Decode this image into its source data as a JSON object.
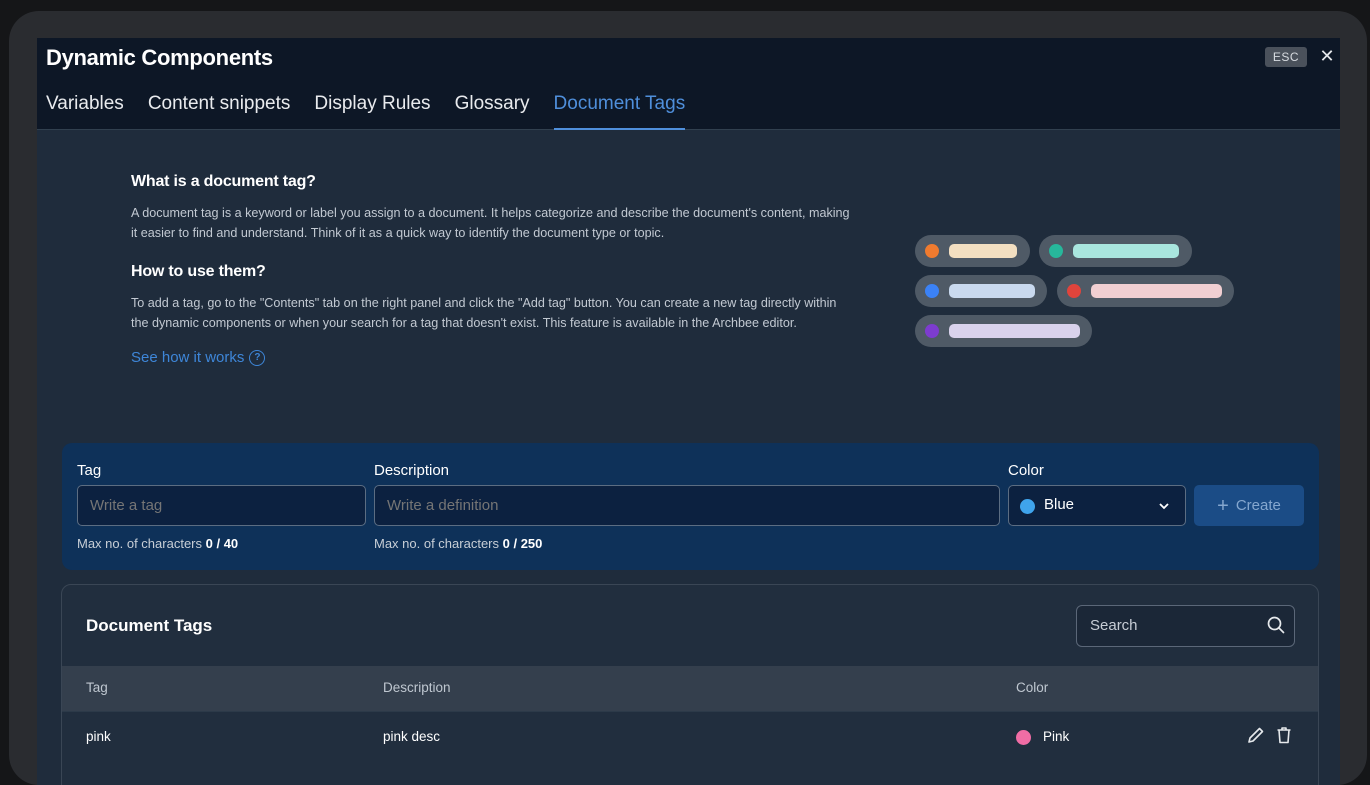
{
  "modal": {
    "title": "Dynamic Components",
    "esc_label": "ESC",
    "close_glyph": "✕"
  },
  "tabs": [
    {
      "label": "Variables",
      "active": false
    },
    {
      "label": "Content snippets",
      "active": false
    },
    {
      "label": "Display Rules",
      "active": false
    },
    {
      "label": "Glossary",
      "active": false
    },
    {
      "label": "Document Tags",
      "active": true
    }
  ],
  "info": {
    "heading1": "What is a document tag?",
    "para1": "A document tag is a keyword or label you assign to a document. It helps categorize and describe the document's content, making it easier to find and understand. Think of it as a quick way to identify the document type or topic.",
    "heading2": "How to use them?",
    "para2": "To add a tag, go to the \"Contents\" tab on the right panel and click the \"Add tag\" button. You can create a new tag directly within the dynamic components or when your search for a tag that doesn't exist. This feature is available in the Archbee editor.",
    "link": "See how it works",
    "help_glyph": "?"
  },
  "illustration_colors": {
    "orange_dot": "#f07b2f",
    "orange_bar": "#f3dfc1",
    "teal_dot": "#27b79b",
    "teal_bar": "#a9e6de",
    "blue_dot": "#3b82f6",
    "blue_bar": "#c9d9ee",
    "red_dot": "#e0443c",
    "red_bar": "#f1cfd2",
    "purple_dot": "#7d3ccf",
    "purple_bar": "#d9d2ec"
  },
  "form": {
    "tag_label": "Tag",
    "tag_placeholder": "Write a tag",
    "tag_hint": "Max no. of characters",
    "tag_count": "0 / 40",
    "desc_label": "Description",
    "desc_placeholder": "Write a definition",
    "desc_hint": "Max no. of characters",
    "desc_count": "0 / 250",
    "color_label": "Color",
    "color_value": "Blue",
    "color_hex": "#3fa4ec",
    "chevron": "⌄",
    "create_plus": "+",
    "create_label": "Create"
  },
  "tags_table": {
    "title": "Document Tags",
    "search_placeholder": "Search",
    "columns": [
      "Tag",
      "Description",
      "Color"
    ],
    "rows": [
      {
        "tag": "pink",
        "description": "pink desc",
        "color": "Pink",
        "color_hex": "#f06da5"
      }
    ]
  }
}
